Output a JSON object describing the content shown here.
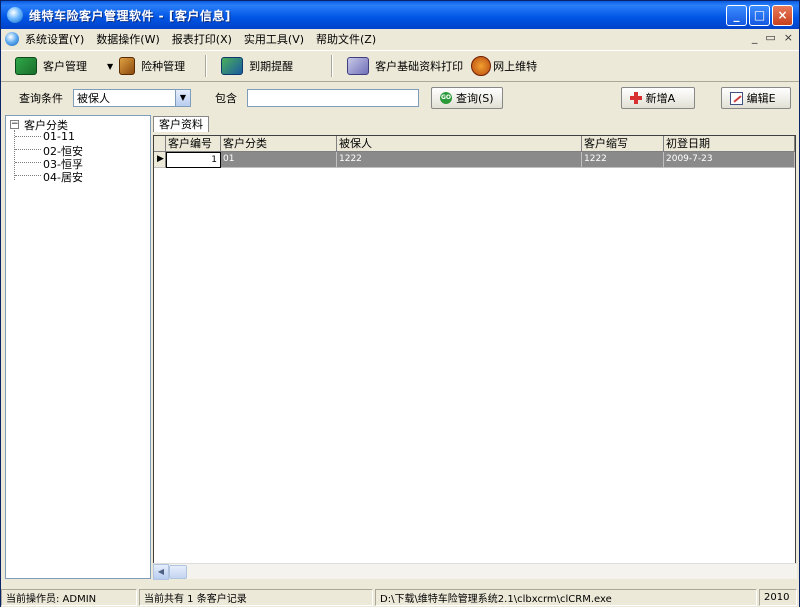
{
  "window": {
    "title": "维特车险客户管理软件 - [客户信息]",
    "min": "_",
    "max": "□",
    "close": "×"
  },
  "menu": {
    "items": [
      "系统设置(Y)",
      "数据操作(W)",
      "报表打印(X)",
      "实用工具(V)",
      "帮助文件(Z)"
    ],
    "mdi_controls": [
      "_",
      "▭",
      "×"
    ]
  },
  "toolbar": {
    "customer_mgmt": "客户管理",
    "insurance_mgmt": "险种管理",
    "expiry_reminder": "到期提醒",
    "print_basic": "客户基础资料打印",
    "online": "网上维特"
  },
  "query": {
    "condition_label": "查询条件",
    "condition_value": "被保人",
    "contains_label": "包含",
    "contains_value": "",
    "query_button": "查询(S)",
    "add_button": "新增A",
    "edit_button": "编辑E"
  },
  "tree": {
    "root": "客户分类",
    "items": [
      "01-11",
      "02-恒安",
      "03-恒孚",
      "04-居安"
    ]
  },
  "tab": {
    "label": "客户资料"
  },
  "table": {
    "columns": [
      "客户编号",
      "客户分类",
      "被保人",
      "客户缩写",
      "初登日期"
    ],
    "rows": [
      {
        "id": "1",
        "category": "01",
        "insured": "1222",
        "abbr": "1222",
        "date": "2009-7-23"
      }
    ]
  },
  "status": {
    "operator": "当前操作员: ADMIN",
    "count": "当前共有 1 条客户记录",
    "path": "D:\\下载\\维特车险管理系统2.1\\clbxcrm\\clCRM.exe",
    "year": "2010"
  }
}
